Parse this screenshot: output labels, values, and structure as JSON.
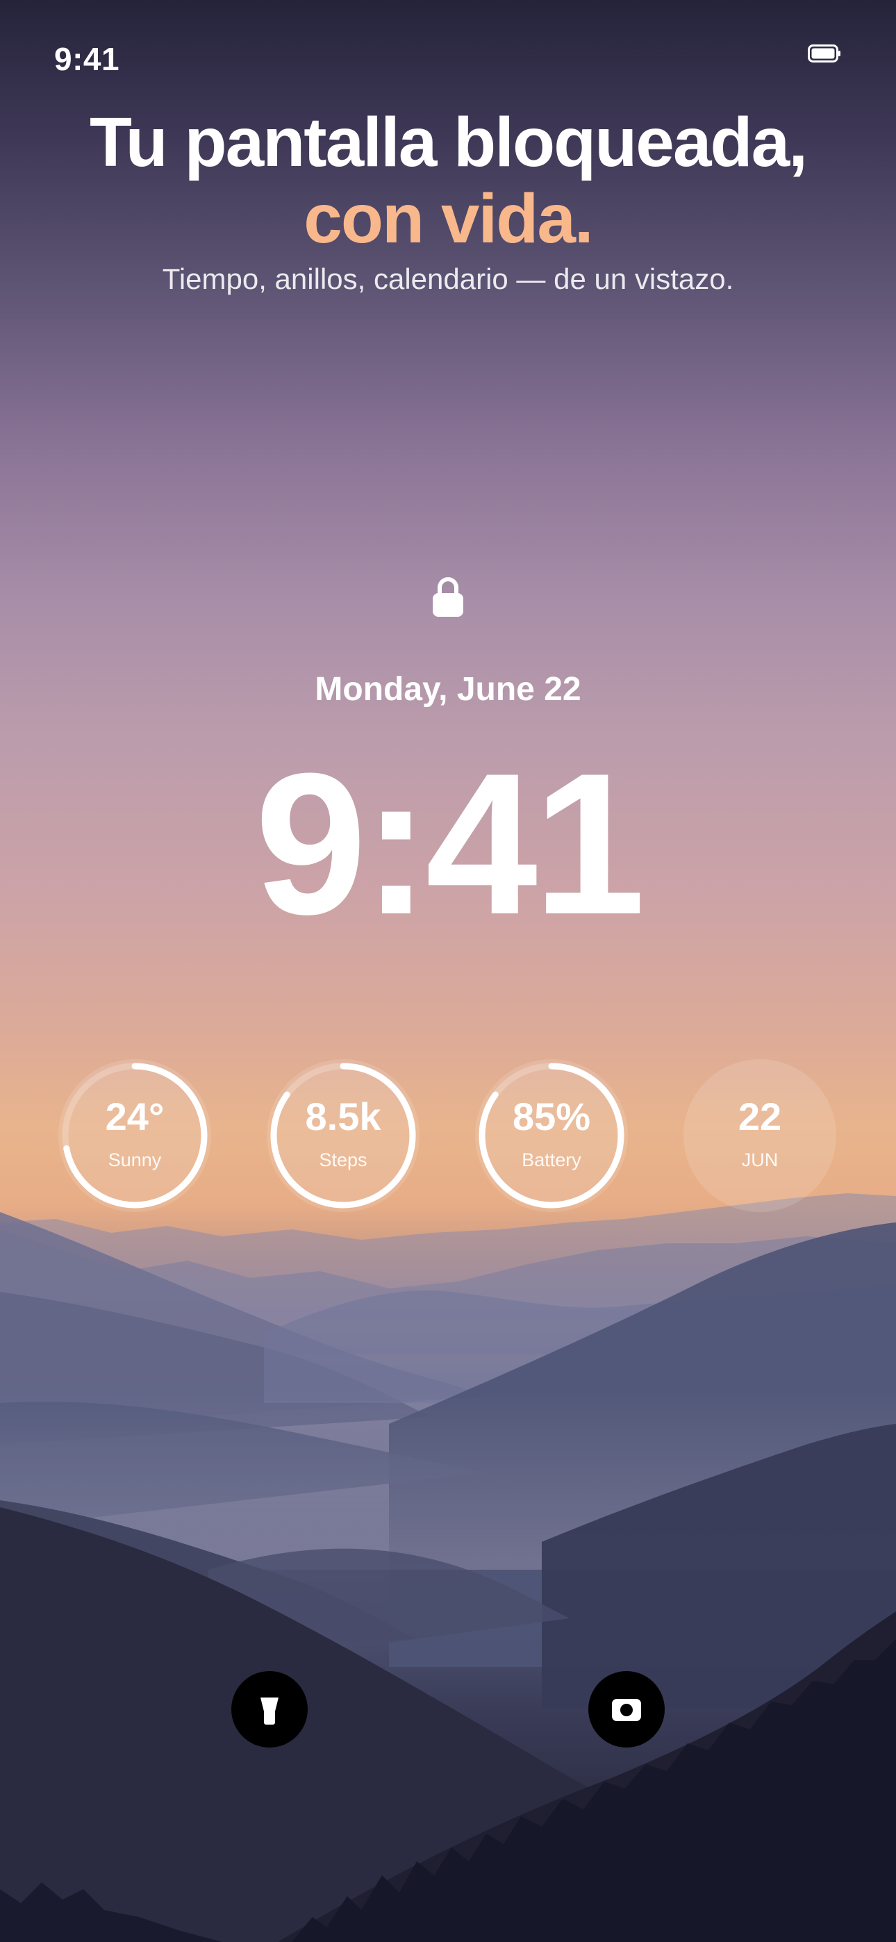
{
  "status_bar": {
    "time": "9:41",
    "battery_icon": "battery-icon"
  },
  "headline": {
    "line1": "Tu pantalla bloqueada,",
    "line2": "con vida.",
    "accent_color": "#f8b88c"
  },
  "subhead": "Tiempo, anillos, calendario — de un vistazo.",
  "lock_screen": {
    "lock_icon": "lock-icon",
    "date": "Monday, June 22",
    "time": "9:41"
  },
  "widgets": [
    {
      "value": "24°",
      "label": "Sunny",
      "progress": 0.72
    },
    {
      "value": "8.5k",
      "label": "Steps",
      "progress": 0.85
    },
    {
      "value": "85%",
      "label": "Battery",
      "progress": 0.85
    },
    {
      "value": "22",
      "label": "JUN",
      "progress": 0
    }
  ],
  "actions": {
    "left_icon": "flashlight-icon",
    "right_icon": "camera-icon"
  }
}
